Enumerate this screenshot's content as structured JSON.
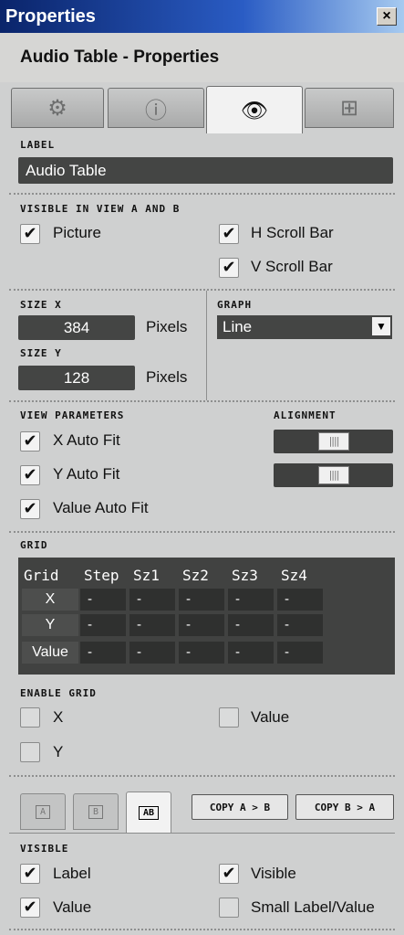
{
  "window": {
    "title": "Properties",
    "close_glyph": "×"
  },
  "header": {
    "title": "Audio Table - Properties"
  },
  "tabs": [
    {
      "name": "function",
      "icon": "gears-icon"
    },
    {
      "name": "info",
      "icon": "info-icon"
    },
    {
      "name": "view",
      "icon": "eye-icon",
      "active": true
    },
    {
      "name": "connections",
      "icon": "structure-icon"
    }
  ],
  "label_section": {
    "heading": "LABEL",
    "value": "Audio Table"
  },
  "visible_ab": {
    "heading": "VISIBLE IN VIEW A AND B",
    "picture": {
      "label": "Picture",
      "checked": true
    },
    "h_scroll": {
      "label": "H Scroll Bar",
      "checked": true
    },
    "v_scroll": {
      "label": "V Scroll Bar",
      "checked": true
    }
  },
  "size": {
    "x_heading": "SIZE X",
    "x_value": "384",
    "y_heading": "SIZE Y",
    "y_value": "128",
    "unit": "Pixels"
  },
  "graph": {
    "heading": "GRAPH",
    "value": "Line",
    "arrow": "▼"
  },
  "view_params": {
    "heading": "VIEW PARAMETERS",
    "alignment_heading": "ALIGNMENT",
    "x_auto": {
      "label": "X Auto Fit",
      "checked": true
    },
    "y_auto": {
      "label": "Y Auto Fit",
      "checked": true
    },
    "value_auto": {
      "label": "Value Auto Fit",
      "checked": true
    },
    "alignment_thumb": "||||",
    "alignment_x_position": 0.5,
    "alignment_y_position": 0.5
  },
  "grid": {
    "heading": "GRID",
    "columns": [
      "Grid",
      "Step",
      "Sz1",
      "Sz2",
      "Sz3",
      "Sz4"
    ],
    "rows": [
      {
        "label": "X",
        "cells": [
          "-",
          "-",
          "-",
          "-",
          "-"
        ]
      },
      {
        "label": "Y",
        "cells": [
          "-",
          "-",
          "-",
          "-",
          "-"
        ]
      },
      {
        "label": "Value",
        "cells": [
          "-",
          "-",
          "-",
          "-",
          "-"
        ]
      }
    ]
  },
  "enable_grid": {
    "heading": "ENABLE GRID",
    "x": {
      "label": "X",
      "checked": false
    },
    "value": {
      "label": "Value",
      "checked": false
    },
    "y": {
      "label": "Y",
      "checked": false
    }
  },
  "view_tabs": {
    "a": "A",
    "b": "B",
    "ab": "AB",
    "copy_ab": "COPY A > B",
    "copy_ba": "COPY B > A"
  },
  "visible": {
    "heading": "VISIBLE",
    "label": {
      "label": "Label",
      "checked": true
    },
    "visible": {
      "label": "Visible",
      "checked": true
    },
    "value": {
      "label": "Value",
      "checked": true
    },
    "small_label": {
      "label": "Small Label/Value",
      "checked": false
    }
  },
  "check_glyph": "✔"
}
